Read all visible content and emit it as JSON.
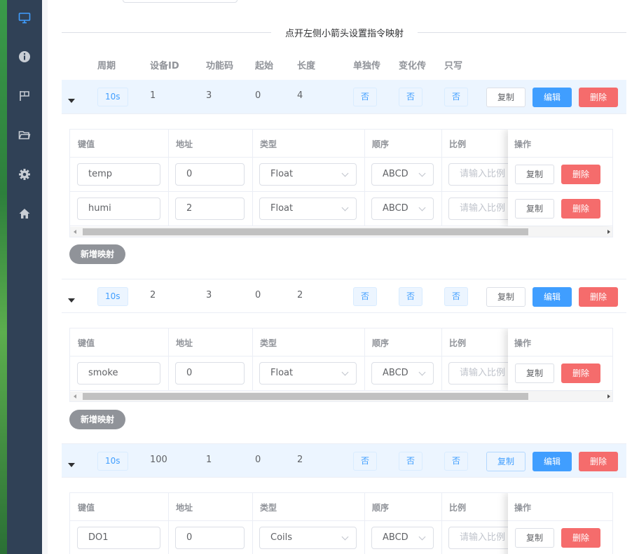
{
  "sidebar": {
    "items": [
      {
        "icon": "monitor-icon",
        "active": true
      },
      {
        "icon": "info-icon",
        "active": false
      },
      {
        "icon": "flag-icon",
        "active": false
      },
      {
        "icon": "folder-icon",
        "active": false
      },
      {
        "icon": "gear-icon",
        "active": false
      },
      {
        "icon": "home-icon",
        "active": false
      }
    ]
  },
  "divider_text": "点开左侧小箭头设置指令映射",
  "columns": {
    "period": "周期",
    "device_id": "设备ID",
    "func_code": "功能码",
    "start": "起始",
    "length": "长度",
    "single": "单独传",
    "change": "变化传",
    "write_only": "只写"
  },
  "buttons": {
    "copy": "复制",
    "edit": "编辑",
    "delete": "删除",
    "add_mapping": "新增映射"
  },
  "sub_columns": {
    "key": "键值",
    "address": "地址",
    "type": "类型",
    "order": "顺序",
    "ratio": "比例",
    "action": "操作"
  },
  "ratio_placeholder": "请输入比例",
  "commands": [
    {
      "period": "10s",
      "device_id": "1",
      "func_code": "3",
      "start": "0",
      "length": "4",
      "single": "否",
      "change": "否",
      "write_only": "否",
      "mappings": [
        {
          "key": "temp",
          "address": "0",
          "type": "Float",
          "order": "ABCD"
        },
        {
          "key": "humi",
          "address": "2",
          "type": "Float",
          "order": "ABCD"
        }
      ]
    },
    {
      "period": "10s",
      "device_id": "2",
      "func_code": "3",
      "start": "0",
      "length": "2",
      "single": "否",
      "change": "否",
      "write_only": "否",
      "mappings": [
        {
          "key": "smoke",
          "address": "0",
          "type": "Float",
          "order": "ABCD"
        }
      ]
    },
    {
      "period": "10s",
      "device_id": "100",
      "func_code": "1",
      "start": "0",
      "length": "2",
      "single": "否",
      "change": "否",
      "write_only": "否",
      "mappings": [
        {
          "key": "DO1",
          "address": "0",
          "type": "Coils",
          "order": "ABCD"
        }
      ]
    }
  ],
  "colors": {
    "sidebar_bg": "#304156",
    "active_icon": "#409eff",
    "primary": "#409eff",
    "danger": "#f56c6c",
    "tag_bg": "#ecf5ff"
  }
}
